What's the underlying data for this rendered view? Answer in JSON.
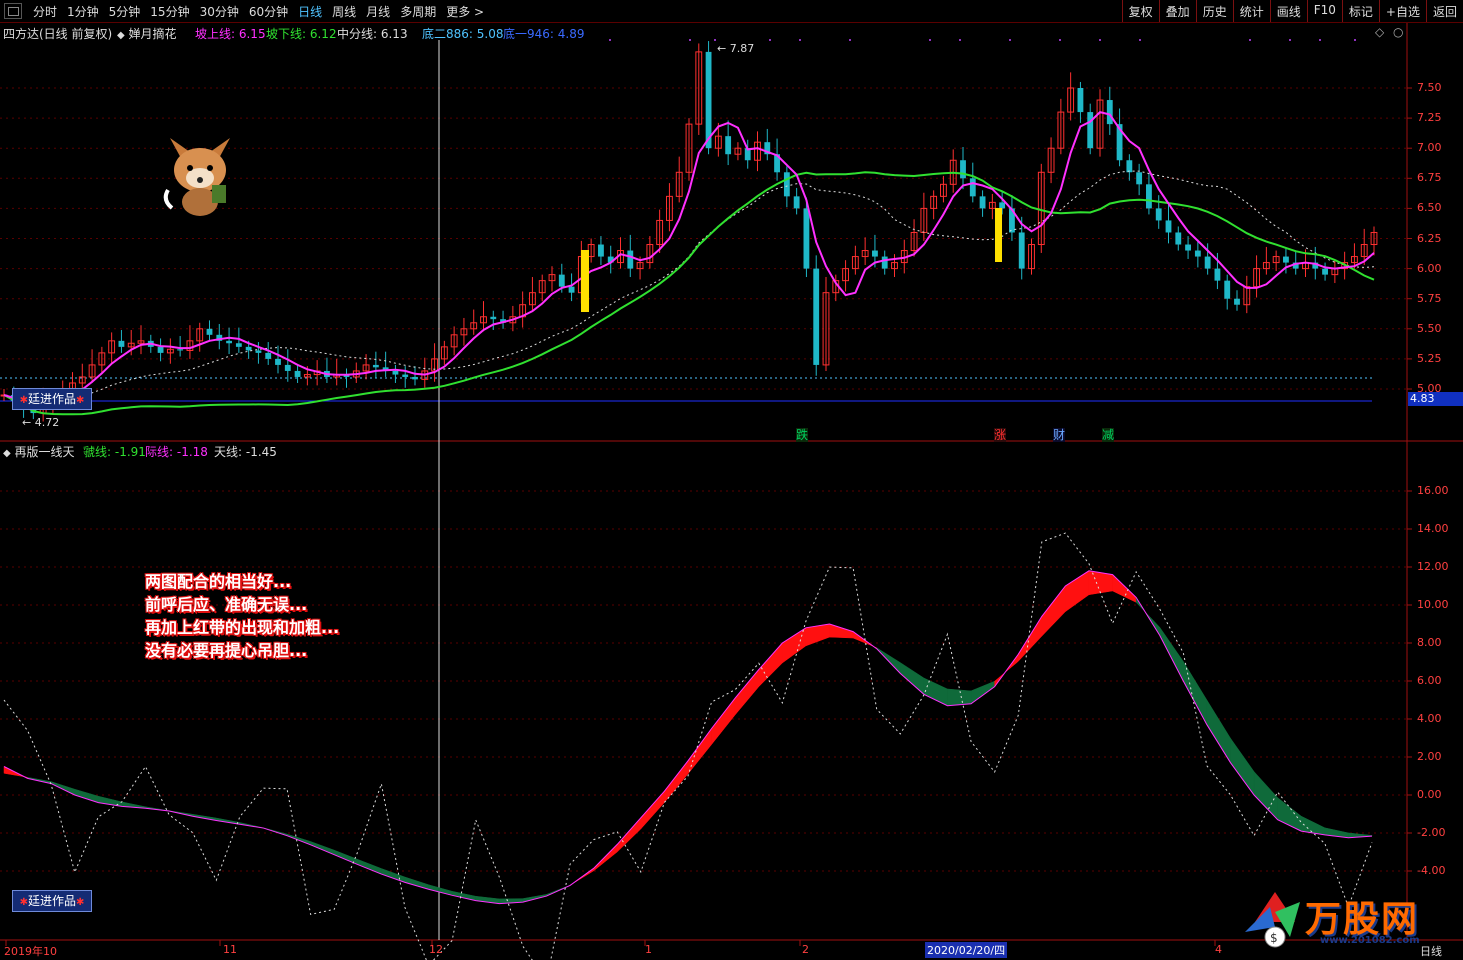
{
  "toolbar": {
    "periods": [
      "分时",
      "1分钟",
      "5分钟",
      "15分钟",
      "30分钟",
      "60分钟",
      "日线",
      "周线",
      "月线",
      "多周期",
      "更多 >"
    ],
    "active": "日线",
    "right": [
      "复权",
      "叠加",
      "历史",
      "统计",
      "画线",
      "F10",
      "标记",
      "+自选",
      "返回"
    ]
  },
  "main_header": {
    "title": "四方达(日线 前复权)",
    "indicator": "婵月摘花",
    "up_line": "坡上线: 6.15",
    "down_line": "坡下线: 6.12",
    "mid_line": "中分线: 6.13",
    "low2": "底二886: 5.08",
    "low1": "底一946: 4.89"
  },
  "main_axis": [
    "7.50",
    "7.25",
    "7.00",
    "6.75",
    "6.50",
    "6.25",
    "6.00",
    "5.75",
    "5.50",
    "5.25",
    "5.00"
  ],
  "high_label": "7.87",
  "low_label": "4.72",
  "price_tag": "4.83",
  "logo_text": "廷进作品",
  "events": [
    {
      "text": "跌",
      "color": "#00d060",
      "bg": "#0a2a0a"
    },
    {
      "text": "涨",
      "color": "#ff3030",
      "bg": "#2a0a0a"
    },
    {
      "text": "财",
      "color": "#6aa8ff",
      "bg": "#0a0a2a"
    },
    {
      "text": "减",
      "color": "#00d060",
      "bg": "#0a2a0a"
    }
  ],
  "sub_header": {
    "title": "再版一线天",
    "l1": "虢线: -1.91",
    "l2": "际线: -1.18",
    "l3": "天线: -1.45"
  },
  "sub_axis": [
    "16.00",
    "14.00",
    "12.00",
    "10.00",
    "8.00",
    "6.00",
    "4.00",
    "2.00",
    "0.00",
    "-2.00",
    "-4.00"
  ],
  "note_lines": [
    "两图配合的相当好...",
    "前呼后应、准确无误...",
    "再加上红带的出现和加粗...",
    "没有必要再提心吊胆..."
  ],
  "dates": [
    "2019年10",
    "11",
    "12",
    "1",
    "2",
    "4"
  ],
  "date_selected": "2020/02/20/四",
  "period_tag": "日线",
  "watermark": "万股网",
  "watermark_url": "www.201082.com",
  "colors": {
    "up": "#ff3030",
    "down": "#1fb8c8",
    "magenta": "#ff30ff",
    "green": "#30e030"
  }
}
